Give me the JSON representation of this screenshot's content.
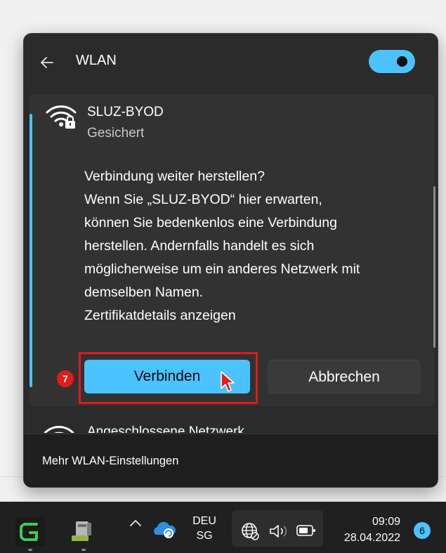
{
  "wlan_flyout": {
    "title": "WLAN",
    "toggle_state": "on",
    "network": {
      "name": "SLUZ-BYOD",
      "status": "Gesichert",
      "message_lines": [
        "Verbindung weiter herstellen?",
        "Wenn Sie „SLUZ-BYOD“ hier erwarten,",
        "können Sie bedenkenlos eine Verbindung",
        "herstellen. Andernfalls handelt es sich",
        "möglicherweise um ein anderes Netzwerk mit",
        "demselben Namen.",
        "Zertifikatdetails anzeigen"
      ],
      "connect_label": "Verbinden",
      "cancel_label": "Abbrechen"
    },
    "next_network_label": "Angeschlossene Netzwerk",
    "footer_label": "Mehr WLAN-Einstellungen"
  },
  "annotation": {
    "step_number": "7",
    "highlight_color": "#e01b1b"
  },
  "taskbar": {
    "language_line1": "DEU",
    "language_line2": "SG",
    "time": "09:09",
    "date": "28.04.2022",
    "notification_count": "6"
  },
  "colors": {
    "accent": "#4cc2ff",
    "flyout_bg": "#2b2b2b",
    "panel_bg": "#323232",
    "taskbar_bg": "#202020"
  },
  "icons": {
    "back": "arrow-left-icon",
    "wifi_secured": "wifi-lock-icon",
    "cursor": "mouse-pointer-icon",
    "chevron_up": "chevron-up-icon",
    "cloud": "onedrive-icon",
    "network": "globe-network-icon",
    "volume": "speaker-icon",
    "battery": "battery-icon"
  }
}
